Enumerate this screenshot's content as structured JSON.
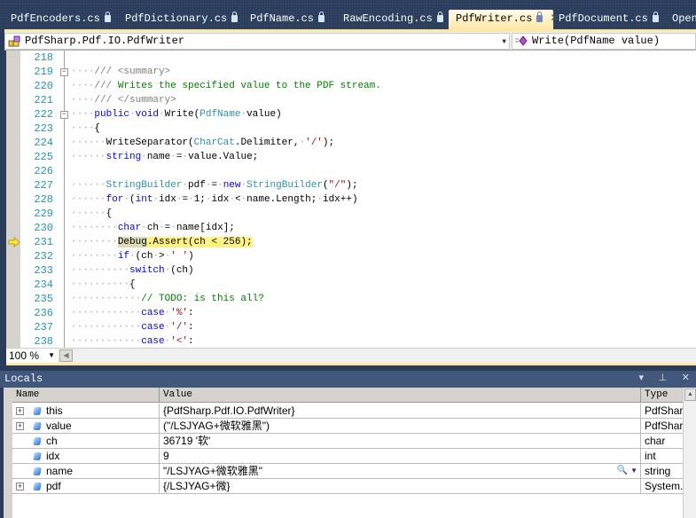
{
  "tabs": [
    {
      "label": "PdfEncoders.cs",
      "active": false
    },
    {
      "label": "PdfDictionary.cs",
      "active": false
    },
    {
      "label": "PdfName.cs",
      "active": false
    },
    {
      "label": "RawEncoding.cs",
      "active": false
    },
    {
      "label": "PdfWriter.cs",
      "active": true
    },
    {
      "label": "PdfDocument.cs",
      "active": false
    },
    {
      "label": "OpenT",
      "active": false
    }
  ],
  "tab_close": "✕",
  "navbar": {
    "type_combo": "PdfSharp.Pdf.IO.PdfWriter",
    "member_combo": "Write(PdfName value)"
  },
  "editor": {
    "current_line": 231,
    "lines": [
      {
        "n": "218",
        "fold": "",
        "tokens": []
      },
      {
        "n": "219",
        "fold": "−",
        "tokens": [
          [
            "ws",
            "    "
          ],
          [
            "xd",
            "/// <summary>"
          ]
        ]
      },
      {
        "n": "220",
        "fold": "",
        "tokens": [
          [
            "ws",
            "    "
          ],
          [
            "xd",
            "/// "
          ],
          [
            "cm",
            "Writes the specified value to the PDF stream."
          ]
        ]
      },
      {
        "n": "221",
        "fold": "",
        "tokens": [
          [
            "ws",
            "    "
          ],
          [
            "xd",
            "/// </summary>"
          ]
        ]
      },
      {
        "n": "222",
        "fold": "−",
        "tokens": [
          [
            "ws",
            "    "
          ],
          [
            "kw",
            "public"
          ],
          [
            "ws",
            " "
          ],
          [
            "kw",
            "void"
          ],
          [
            "ws",
            " "
          ],
          [
            "tx",
            "Write("
          ],
          [
            "ty",
            "PdfName"
          ],
          [
            "ws",
            " "
          ],
          [
            "tx",
            "value)"
          ]
        ]
      },
      {
        "n": "223",
        "fold": "",
        "tokens": [
          [
            "ws",
            "    "
          ],
          [
            "tx",
            "{"
          ]
        ]
      },
      {
        "n": "224",
        "fold": "",
        "tokens": [
          [
            "ws",
            "      "
          ],
          [
            "tx",
            "WriteSeparator("
          ],
          [
            "ty",
            "CharCat"
          ],
          [
            "tx",
            ".Delimiter,"
          ],
          [
            "ws",
            " "
          ],
          [
            "st",
            "'/'"
          ],
          [
            "tx",
            ");"
          ]
        ]
      },
      {
        "n": "225",
        "fold": "",
        "tokens": [
          [
            "ws",
            "      "
          ],
          [
            "kw",
            "string"
          ],
          [
            "ws",
            " "
          ],
          [
            "tx",
            "name"
          ],
          [
            "ws",
            " "
          ],
          [
            "tx",
            "="
          ],
          [
            "ws",
            " "
          ],
          [
            "tx",
            "value.Value;"
          ]
        ]
      },
      {
        "n": "226",
        "fold": "",
        "tokens": []
      },
      {
        "n": "227",
        "fold": "",
        "tokens": [
          [
            "ws",
            "      "
          ],
          [
            "ty",
            "StringBuilder"
          ],
          [
            "ws",
            " "
          ],
          [
            "tx",
            "pdf"
          ],
          [
            "ws",
            " "
          ],
          [
            "tx",
            "="
          ],
          [
            "ws",
            " "
          ],
          [
            "kw",
            "new"
          ],
          [
            "ws",
            " "
          ],
          [
            "ty",
            "StringBuilder"
          ],
          [
            "tx",
            "("
          ],
          [
            "st",
            "\"/\""
          ],
          [
            "tx",
            ");"
          ]
        ]
      },
      {
        "n": "228",
        "fold": "",
        "tokens": [
          [
            "ws",
            "      "
          ],
          [
            "kw",
            "for"
          ],
          [
            "ws",
            " "
          ],
          [
            "tx",
            "("
          ],
          [
            "kw",
            "int"
          ],
          [
            "ws",
            " "
          ],
          [
            "tx",
            "idx"
          ],
          [
            "ws",
            " "
          ],
          [
            "tx",
            "="
          ],
          [
            "ws",
            " "
          ],
          [
            "tx",
            "1;"
          ],
          [
            "ws",
            " "
          ],
          [
            "tx",
            "idx"
          ],
          [
            "ws",
            " "
          ],
          [
            "tx",
            "<"
          ],
          [
            "ws",
            " "
          ],
          [
            "tx",
            "name.Length;"
          ],
          [
            "ws",
            " "
          ],
          [
            "tx",
            "idx++)"
          ]
        ]
      },
      {
        "n": "229",
        "fold": "",
        "tokens": [
          [
            "ws",
            "      "
          ],
          [
            "tx",
            "{"
          ]
        ]
      },
      {
        "n": "230",
        "fold": "",
        "tokens": [
          [
            "ws",
            "        "
          ],
          [
            "kw",
            "char"
          ],
          [
            "ws",
            " "
          ],
          [
            "tx",
            "ch"
          ],
          [
            "ws",
            " "
          ],
          [
            "tx",
            "="
          ],
          [
            "ws",
            " "
          ],
          [
            "tx",
            "name[idx];"
          ]
        ]
      },
      {
        "n": "231",
        "fold": "",
        "tokens": [
          [
            "ws",
            "        "
          ],
          [
            "hl0",
            "Debug"
          ],
          [
            "hl",
            ".Assert(ch < 256);"
          ]
        ]
      },
      {
        "n": "232",
        "fold": "",
        "tokens": [
          [
            "ws",
            "        "
          ],
          [
            "kw",
            "if"
          ],
          [
            "ws",
            " "
          ],
          [
            "tx",
            "(ch"
          ],
          [
            "ws",
            " "
          ],
          [
            "tx",
            ">"
          ],
          [
            "ws",
            " "
          ],
          [
            "st",
            "' '"
          ],
          [
            "tx",
            ")"
          ]
        ]
      },
      {
        "n": "233",
        "fold": "",
        "tokens": [
          [
            "ws",
            "          "
          ],
          [
            "kw",
            "switch"
          ],
          [
            "ws",
            " "
          ],
          [
            "tx",
            "(ch)"
          ]
        ]
      },
      {
        "n": "234",
        "fold": "",
        "tokens": [
          [
            "ws",
            "          "
          ],
          [
            "tx",
            "{"
          ]
        ]
      },
      {
        "n": "235",
        "fold": "",
        "tokens": [
          [
            "ws",
            "            "
          ],
          [
            "cm",
            "// TODO: is this all?"
          ]
        ]
      },
      {
        "n": "236",
        "fold": "",
        "tokens": [
          [
            "ws",
            "            "
          ],
          [
            "kw",
            "case"
          ],
          [
            "ws",
            " "
          ],
          [
            "st",
            "'%'"
          ],
          [
            "tx",
            ":"
          ]
        ]
      },
      {
        "n": "237",
        "fold": "",
        "tokens": [
          [
            "ws",
            "            "
          ],
          [
            "kw",
            "case"
          ],
          [
            "ws",
            " "
          ],
          [
            "st",
            "'/'"
          ],
          [
            "tx",
            ":"
          ]
        ]
      },
      {
        "n": "238",
        "fold": "",
        "tokens": [
          [
            "ws",
            "            "
          ],
          [
            "kw",
            "case"
          ],
          [
            "ws",
            " "
          ],
          [
            "st",
            "'<'"
          ],
          [
            "tx",
            ":"
          ]
        ]
      }
    ]
  },
  "zoom": {
    "value": "100 %"
  },
  "locals": {
    "title": "Locals",
    "panel_buttons": "▾ ⊥ ✕",
    "columns": [
      "Name",
      "Value",
      "Type"
    ],
    "rows": [
      {
        "name": "this",
        "value": "{PdfSharp.Pdf.IO.PdfWriter}",
        "type": "PdfSharp.Pdf.IO.PdfWriter",
        "expandable": true
      },
      {
        "name": "value",
        "value": "(\"/LSJYAG+微软雅黑\")",
        "type": "PdfSharp.Pdf.PdfName",
        "expandable": true
      },
      {
        "name": "ch",
        "value": "36719 '软'",
        "type": "char",
        "expandable": false
      },
      {
        "name": "idx",
        "value": "9",
        "type": "int",
        "expandable": false
      },
      {
        "name": "name",
        "value": "\"/LSJYAG+微软雅黑\"",
        "type": "string",
        "expandable": false,
        "visualizer": true
      },
      {
        "name": "pdf",
        "value": "{/LSJYAG+微}",
        "type": "System.Text.StringBuilder",
        "expandable": true
      }
    ]
  }
}
